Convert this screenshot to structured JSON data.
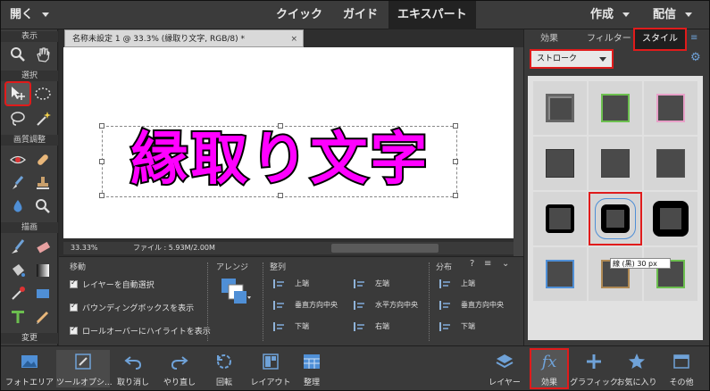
{
  "topbar": {
    "open_label": "開く",
    "modes": [
      "クイック",
      "ガイド",
      "エキスパート"
    ],
    "create_label": "作成",
    "share_label": "配信"
  },
  "toolbox": {
    "sections": [
      "表示",
      "選択",
      "画質調整",
      "描画",
      "変更"
    ]
  },
  "document": {
    "tab_title": "名称未設定 1 @ 33.3% (縁取り文字, RGB/8) *",
    "canvas_text": "縁取り文字",
    "zoom": "33.33%",
    "file_info": "ファイル : 5.93M/2.00M"
  },
  "options": {
    "section_move": "移動",
    "section_arrange": "アレンジ",
    "section_align": "整列",
    "section_distribute": "分布",
    "checkbox_auto_select": "レイヤーを自動選択",
    "checkbox_bounding_box": "バウンディングボックスを表示",
    "checkbox_rollover": "ロールオーバーにハイライトを表示",
    "align_top": "上端",
    "align_vcenter": "垂直方向中央",
    "align_bottom": "下端",
    "align_left": "左端",
    "align_hcenter": "水平方向中央",
    "align_right": "右端",
    "dist_top": "上端",
    "dist_vcenter": "垂直方向中央",
    "dist_bottom": "下端"
  },
  "right_panel": {
    "tabs": [
      "効果",
      "フィルター",
      "スタイル"
    ],
    "dropdown_value": "ストローク",
    "tooltip": "線 (黒) 30 px"
  },
  "bottombar": {
    "items": [
      "フォトエリア",
      "ツールオプシ...",
      "取り消し",
      "やり直し",
      "回転",
      "レイアウト",
      "整理",
      "レイヤー",
      "効果",
      "グラフィック",
      "お気に入り",
      "その他"
    ]
  },
  "colors": {
    "accent_highlight": "#e01b1b",
    "text_fill": "#ff00ff",
    "text_stroke": "#000000"
  }
}
